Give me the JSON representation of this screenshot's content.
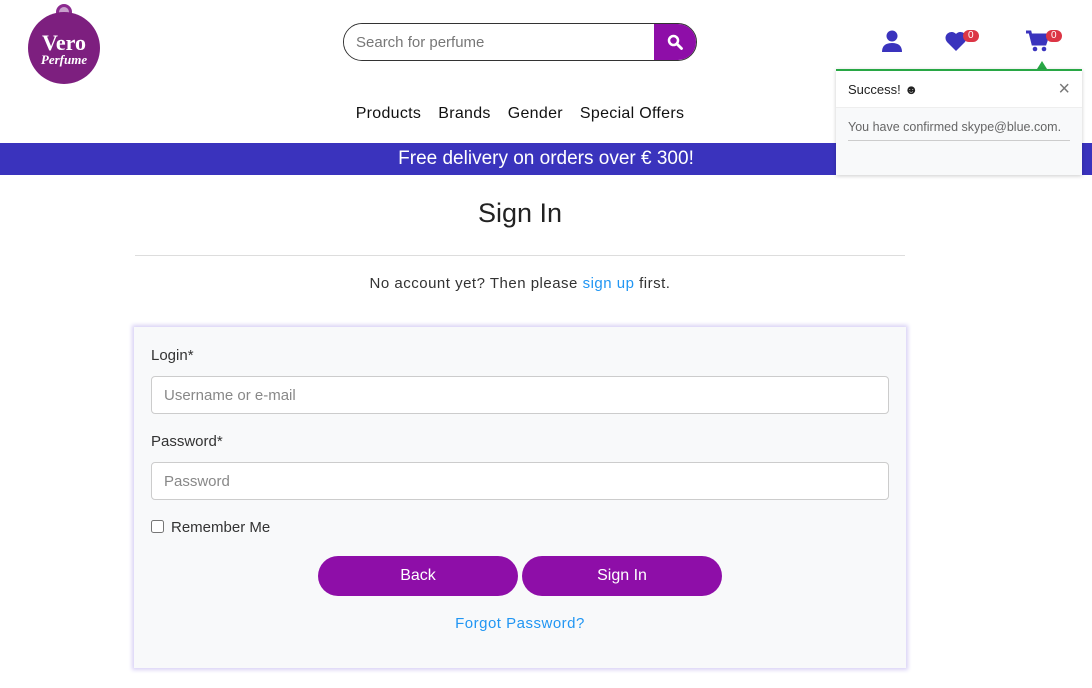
{
  "brand": {
    "logo_line1": "Vero",
    "logo_line2": "Perfume",
    "color": "#8e0ea8"
  },
  "search": {
    "placeholder": "Search for perfume"
  },
  "header": {
    "wishlist_count": "0",
    "cart_count": "0"
  },
  "nav": [
    "Products",
    "Brands",
    "Gender",
    "Special Offers"
  ],
  "banner": "Free delivery on orders over € 300!",
  "page": {
    "title": "Sign In",
    "no_account_pre": "No account yet? Then please ",
    "sign_up": "sign up",
    "no_account_post": " first."
  },
  "form": {
    "login_label": "Login*",
    "login_placeholder": "Username or e-mail",
    "password_label": "Password*",
    "password_placeholder": "Password",
    "remember": "Remember Me",
    "back": "Back",
    "sign_in": "Sign In",
    "forgot": "Forgot Password?"
  },
  "toast": {
    "title": "Success! ☻",
    "message": "You have confirmed skype@blue.com."
  },
  "colors": {
    "accent": "#8e0ea8",
    "banner": "#3a33bd",
    "link": "#2196f3",
    "success": "#28a745"
  }
}
